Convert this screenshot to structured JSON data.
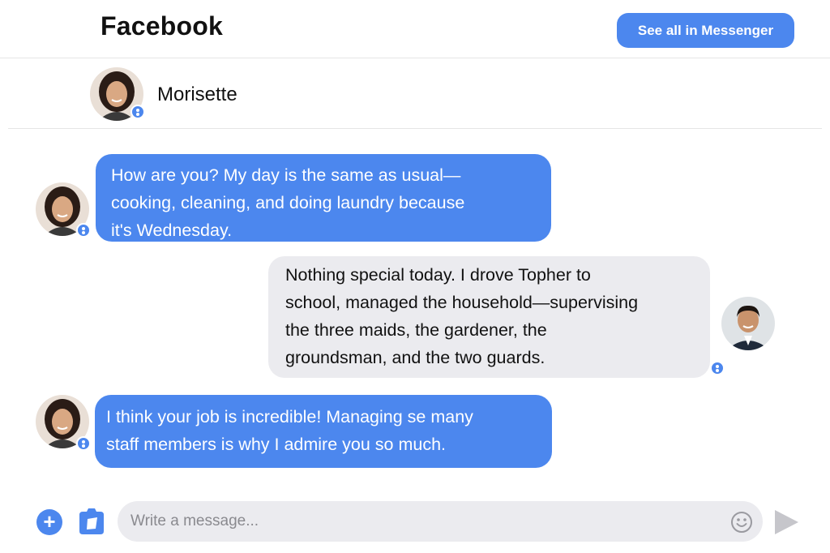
{
  "header": {
    "brand": "Facebook",
    "see_all_label": "See all in Messenger"
  },
  "contact": {
    "name": "Morisette"
  },
  "messages": [
    {
      "direction": "incoming",
      "lines": [
        "How are you? My day is the same as usual—",
        "cooking, cleaning, and doing laundry because",
        "it's Wednesday."
      ]
    },
    {
      "direction": "outgoing",
      "lines": [
        "Nothing special today.  I drove Topher  to",
        "school, managed the household—supervising",
        "the three maids, the gardener, the",
        "groundsman, and the two guards."
      ]
    },
    {
      "direction": "incoming",
      "lines": [
        "I think your job is incredible! Managing se many",
        "staff members is why I admire you so much."
      ]
    }
  ],
  "composer": {
    "placeholder": "Write a message...",
    "add_icon": "plus-circle-icon",
    "photo_icon": "photo-icon",
    "emoji_icon": "smiley-icon",
    "send_icon": "send-icon"
  },
  "colors": {
    "accent": "#4c87ee",
    "incoming_bubble": "#4c87ee",
    "outgoing_bubble": "#ebebef"
  }
}
